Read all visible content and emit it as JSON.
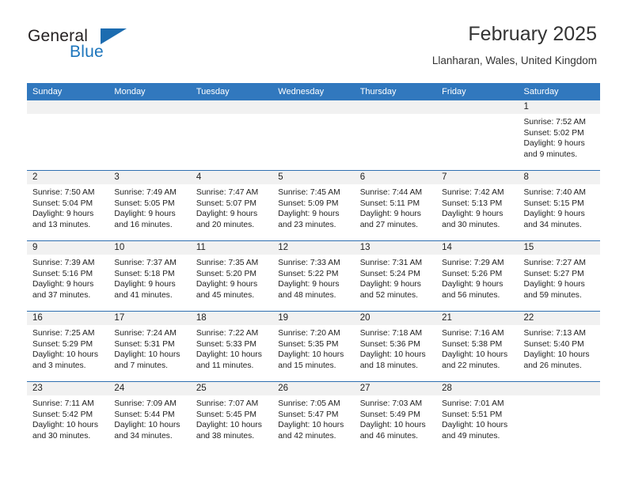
{
  "brand": {
    "name_part1": "General",
    "name_part2": "Blue",
    "accent_color": "#1c75bc",
    "triangle_color": "#1c6cb0"
  },
  "header": {
    "title": "February 2025",
    "subtitle": "Llanharan, Wales, United Kingdom",
    "header_bar_color": "#3178be"
  },
  "weekdays": [
    "Sunday",
    "Monday",
    "Tuesday",
    "Wednesday",
    "Thursday",
    "Friday",
    "Saturday"
  ],
  "labels": {
    "sunrise_prefix": "Sunrise:",
    "sunset_prefix": "Sunset:",
    "daylight_prefix": "Daylight:"
  },
  "weeks": [
    [
      {
        "day": "",
        "sunrise": "",
        "sunset": "",
        "daylight_line1": "",
        "daylight_line2": ""
      },
      {
        "day": "",
        "sunrise": "",
        "sunset": "",
        "daylight_line1": "",
        "daylight_line2": ""
      },
      {
        "day": "",
        "sunrise": "",
        "sunset": "",
        "daylight_line1": "",
        "daylight_line2": ""
      },
      {
        "day": "",
        "sunrise": "",
        "sunset": "",
        "daylight_line1": "",
        "daylight_line2": ""
      },
      {
        "day": "",
        "sunrise": "",
        "sunset": "",
        "daylight_line1": "",
        "daylight_line2": ""
      },
      {
        "day": "",
        "sunrise": "",
        "sunset": "",
        "daylight_line1": "",
        "daylight_line2": ""
      },
      {
        "day": "1",
        "sunrise": "Sunrise: 7:52 AM",
        "sunset": "Sunset: 5:02 PM",
        "daylight_line1": "Daylight: 9 hours",
        "daylight_line2": "and 9 minutes."
      }
    ],
    [
      {
        "day": "2",
        "sunrise": "Sunrise: 7:50 AM",
        "sunset": "Sunset: 5:04 PM",
        "daylight_line1": "Daylight: 9 hours",
        "daylight_line2": "and 13 minutes."
      },
      {
        "day": "3",
        "sunrise": "Sunrise: 7:49 AM",
        "sunset": "Sunset: 5:05 PM",
        "daylight_line1": "Daylight: 9 hours",
        "daylight_line2": "and 16 minutes."
      },
      {
        "day": "4",
        "sunrise": "Sunrise: 7:47 AM",
        "sunset": "Sunset: 5:07 PM",
        "daylight_line1": "Daylight: 9 hours",
        "daylight_line2": "and 20 minutes."
      },
      {
        "day": "5",
        "sunrise": "Sunrise: 7:45 AM",
        "sunset": "Sunset: 5:09 PM",
        "daylight_line1": "Daylight: 9 hours",
        "daylight_line2": "and 23 minutes."
      },
      {
        "day": "6",
        "sunrise": "Sunrise: 7:44 AM",
        "sunset": "Sunset: 5:11 PM",
        "daylight_line1": "Daylight: 9 hours",
        "daylight_line2": "and 27 minutes."
      },
      {
        "day": "7",
        "sunrise": "Sunrise: 7:42 AM",
        "sunset": "Sunset: 5:13 PM",
        "daylight_line1": "Daylight: 9 hours",
        "daylight_line2": "and 30 minutes."
      },
      {
        "day": "8",
        "sunrise": "Sunrise: 7:40 AM",
        "sunset": "Sunset: 5:15 PM",
        "daylight_line1": "Daylight: 9 hours",
        "daylight_line2": "and 34 minutes."
      }
    ],
    [
      {
        "day": "9",
        "sunrise": "Sunrise: 7:39 AM",
        "sunset": "Sunset: 5:16 PM",
        "daylight_line1": "Daylight: 9 hours",
        "daylight_line2": "and 37 minutes."
      },
      {
        "day": "10",
        "sunrise": "Sunrise: 7:37 AM",
        "sunset": "Sunset: 5:18 PM",
        "daylight_line1": "Daylight: 9 hours",
        "daylight_line2": "and 41 minutes."
      },
      {
        "day": "11",
        "sunrise": "Sunrise: 7:35 AM",
        "sunset": "Sunset: 5:20 PM",
        "daylight_line1": "Daylight: 9 hours",
        "daylight_line2": "and 45 minutes."
      },
      {
        "day": "12",
        "sunrise": "Sunrise: 7:33 AM",
        "sunset": "Sunset: 5:22 PM",
        "daylight_line1": "Daylight: 9 hours",
        "daylight_line2": "and 48 minutes."
      },
      {
        "day": "13",
        "sunrise": "Sunrise: 7:31 AM",
        "sunset": "Sunset: 5:24 PM",
        "daylight_line1": "Daylight: 9 hours",
        "daylight_line2": "and 52 minutes."
      },
      {
        "day": "14",
        "sunrise": "Sunrise: 7:29 AM",
        "sunset": "Sunset: 5:26 PM",
        "daylight_line1": "Daylight: 9 hours",
        "daylight_line2": "and 56 minutes."
      },
      {
        "day": "15",
        "sunrise": "Sunrise: 7:27 AM",
        "sunset": "Sunset: 5:27 PM",
        "daylight_line1": "Daylight: 9 hours",
        "daylight_line2": "and 59 minutes."
      }
    ],
    [
      {
        "day": "16",
        "sunrise": "Sunrise: 7:25 AM",
        "sunset": "Sunset: 5:29 PM",
        "daylight_line1": "Daylight: 10 hours",
        "daylight_line2": "and 3 minutes."
      },
      {
        "day": "17",
        "sunrise": "Sunrise: 7:24 AM",
        "sunset": "Sunset: 5:31 PM",
        "daylight_line1": "Daylight: 10 hours",
        "daylight_line2": "and 7 minutes."
      },
      {
        "day": "18",
        "sunrise": "Sunrise: 7:22 AM",
        "sunset": "Sunset: 5:33 PM",
        "daylight_line1": "Daylight: 10 hours",
        "daylight_line2": "and 11 minutes."
      },
      {
        "day": "19",
        "sunrise": "Sunrise: 7:20 AM",
        "sunset": "Sunset: 5:35 PM",
        "daylight_line1": "Daylight: 10 hours",
        "daylight_line2": "and 15 minutes."
      },
      {
        "day": "20",
        "sunrise": "Sunrise: 7:18 AM",
        "sunset": "Sunset: 5:36 PM",
        "daylight_line1": "Daylight: 10 hours",
        "daylight_line2": "and 18 minutes."
      },
      {
        "day": "21",
        "sunrise": "Sunrise: 7:16 AM",
        "sunset": "Sunset: 5:38 PM",
        "daylight_line1": "Daylight: 10 hours",
        "daylight_line2": "and 22 minutes."
      },
      {
        "day": "22",
        "sunrise": "Sunrise: 7:13 AM",
        "sunset": "Sunset: 5:40 PM",
        "daylight_line1": "Daylight: 10 hours",
        "daylight_line2": "and 26 minutes."
      }
    ],
    [
      {
        "day": "23",
        "sunrise": "Sunrise: 7:11 AM",
        "sunset": "Sunset: 5:42 PM",
        "daylight_line1": "Daylight: 10 hours",
        "daylight_line2": "and 30 minutes."
      },
      {
        "day": "24",
        "sunrise": "Sunrise: 7:09 AM",
        "sunset": "Sunset: 5:44 PM",
        "daylight_line1": "Daylight: 10 hours",
        "daylight_line2": "and 34 minutes."
      },
      {
        "day": "25",
        "sunrise": "Sunrise: 7:07 AM",
        "sunset": "Sunset: 5:45 PM",
        "daylight_line1": "Daylight: 10 hours",
        "daylight_line2": "and 38 minutes."
      },
      {
        "day": "26",
        "sunrise": "Sunrise: 7:05 AM",
        "sunset": "Sunset: 5:47 PM",
        "daylight_line1": "Daylight: 10 hours",
        "daylight_line2": "and 42 minutes."
      },
      {
        "day": "27",
        "sunrise": "Sunrise: 7:03 AM",
        "sunset": "Sunset: 5:49 PM",
        "daylight_line1": "Daylight: 10 hours",
        "daylight_line2": "and 46 minutes."
      },
      {
        "day": "28",
        "sunrise": "Sunrise: 7:01 AM",
        "sunset": "Sunset: 5:51 PM",
        "daylight_line1": "Daylight: 10 hours",
        "daylight_line2": "and 49 minutes."
      },
      {
        "day": "",
        "sunrise": "",
        "sunset": "",
        "daylight_line1": "",
        "daylight_line2": ""
      }
    ]
  ]
}
